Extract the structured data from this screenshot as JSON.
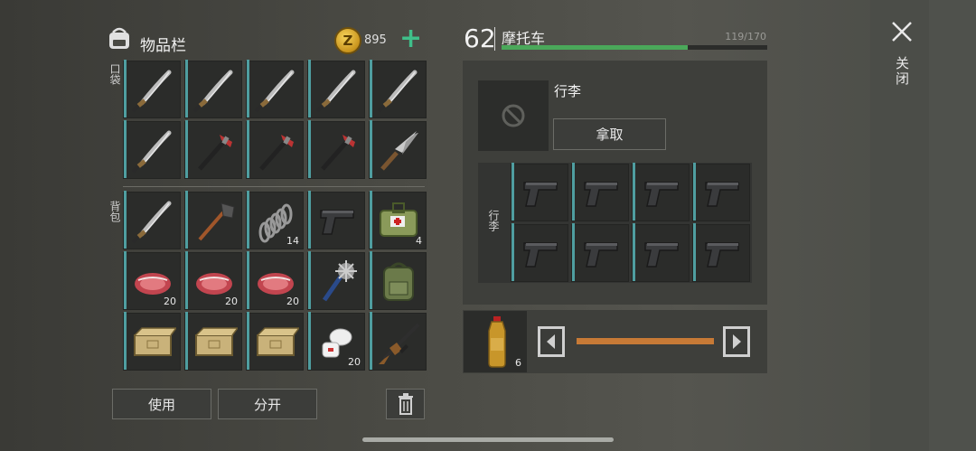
{
  "inventory": {
    "title": "物品栏",
    "coins": "895",
    "plus": "+",
    "coin_symbol": "Z",
    "pocket_label": "口袋",
    "backpack_label": "背包",
    "pocket_slots": [
      {
        "icon": "machete-icon",
        "qty": ""
      },
      {
        "icon": "machete-icon",
        "qty": ""
      },
      {
        "icon": "machete-icon",
        "qty": ""
      },
      {
        "icon": "machete-icon",
        "qty": ""
      },
      {
        "icon": "machete-icon",
        "qty": ""
      },
      {
        "icon": "machete-icon",
        "qty": ""
      },
      {
        "icon": "pickaxe-icon",
        "qty": ""
      },
      {
        "icon": "pickaxe-icon",
        "qty": ""
      },
      {
        "icon": "pickaxe-icon",
        "qty": ""
      },
      {
        "icon": "cleaver-icon",
        "qty": ""
      }
    ],
    "backpack_slots": [
      {
        "icon": "machete-icon",
        "qty": ""
      },
      {
        "icon": "shovel-icon",
        "qty": ""
      },
      {
        "icon": "spring-icon",
        "qty": "14"
      },
      {
        "icon": "pistol-icon",
        "qty": ""
      },
      {
        "icon": "medkit-bag-icon",
        "qty": "4"
      },
      {
        "icon": "meat-icon",
        "qty": "20"
      },
      {
        "icon": "meat-icon",
        "qty": "20"
      },
      {
        "icon": "meat-icon",
        "qty": "20"
      },
      {
        "icon": "spiked-mace-icon",
        "qty": ""
      },
      {
        "icon": "backpack-icon",
        "qty": ""
      },
      {
        "icon": "supply-box-icon",
        "qty": ""
      },
      {
        "icon": "supply-box-icon",
        "qty": ""
      },
      {
        "icon": "supply-box-icon",
        "qty": ""
      },
      {
        "icon": "bandage-icon",
        "qty": "20"
      },
      {
        "icon": "rifle-icon",
        "qty": ""
      }
    ],
    "use_button": "使用",
    "split_button": "分开"
  },
  "vehicle": {
    "level": "62",
    "name": "摩托车",
    "capacity": "119/170",
    "capacity_fraction": 0.7,
    "luggage_title": "行李",
    "take_button": "拿取",
    "luggage_side_label": "行李",
    "luggage_slots": 8,
    "fuel_qty": "6"
  },
  "close_label": "关闭",
  "colors": {
    "accent_teal": "#4f9ea0",
    "capacity_green": "#4aa85a",
    "slider_orange": "#c77a36",
    "plus_green": "#3fbf8a"
  }
}
